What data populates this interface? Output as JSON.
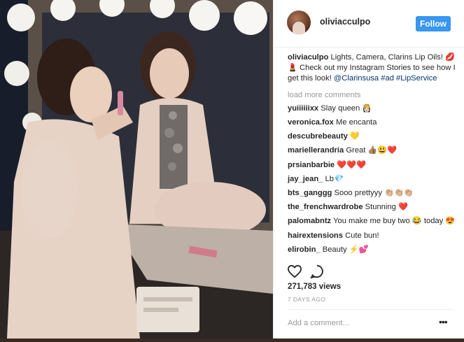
{
  "post": {
    "username": "oliviacculpo",
    "follow_label": "Follow",
    "caption": {
      "username": "oliviaculpo",
      "text_before": "Lights, Camera, Clarins Lip Oils! 💋💄 Check out my Instagram Stories to see how I get this look! ",
      "mention": "@Clarinsusa",
      "tag_ad": "#ad",
      "tag_lip": "#LipService"
    },
    "load_more_label": "load more comments",
    "comments": [
      {
        "user": "yuiiiiiixx",
        "text": "Slay queen 👸🏻"
      },
      {
        "user": "veronica.fox",
        "text": "Me encanta"
      },
      {
        "user": "descubrebeauty",
        "text": "💛"
      },
      {
        "user": "mariellerandria",
        "text": "Great 👍🏽😃❤️"
      },
      {
        "user": "prsianbarbie",
        "text": "❤️❤️❤️"
      },
      {
        "user": "jay_jean_",
        "text": "Lb💎"
      },
      {
        "user": "bts_ganggg",
        "text": "Sooo prettyyy 👏🏼👏🏼👏🏼"
      },
      {
        "user": "the_frenchwardrobe",
        "text": "Stunning ❤️"
      },
      {
        "user": "palomabntz",
        "text": "You make me buy two 😂 today 😍"
      },
      {
        "user": "hairextensions",
        "text": "Cute bun!"
      },
      {
        "user": "elirobin_",
        "text": "Beauty ⚡️💕"
      }
    ],
    "views": "271,783 views",
    "timestamp": "7 DAYS AGO",
    "add_comment_placeholder": "Add a comment...",
    "more_label": "•••",
    "icons": {
      "like": "heart-icon",
      "comment": "comment-icon",
      "more": "more-options-icon"
    },
    "colors": {
      "follow_bg": "#3897f0",
      "link": "#003569",
      "muted": "#999999"
    }
  }
}
